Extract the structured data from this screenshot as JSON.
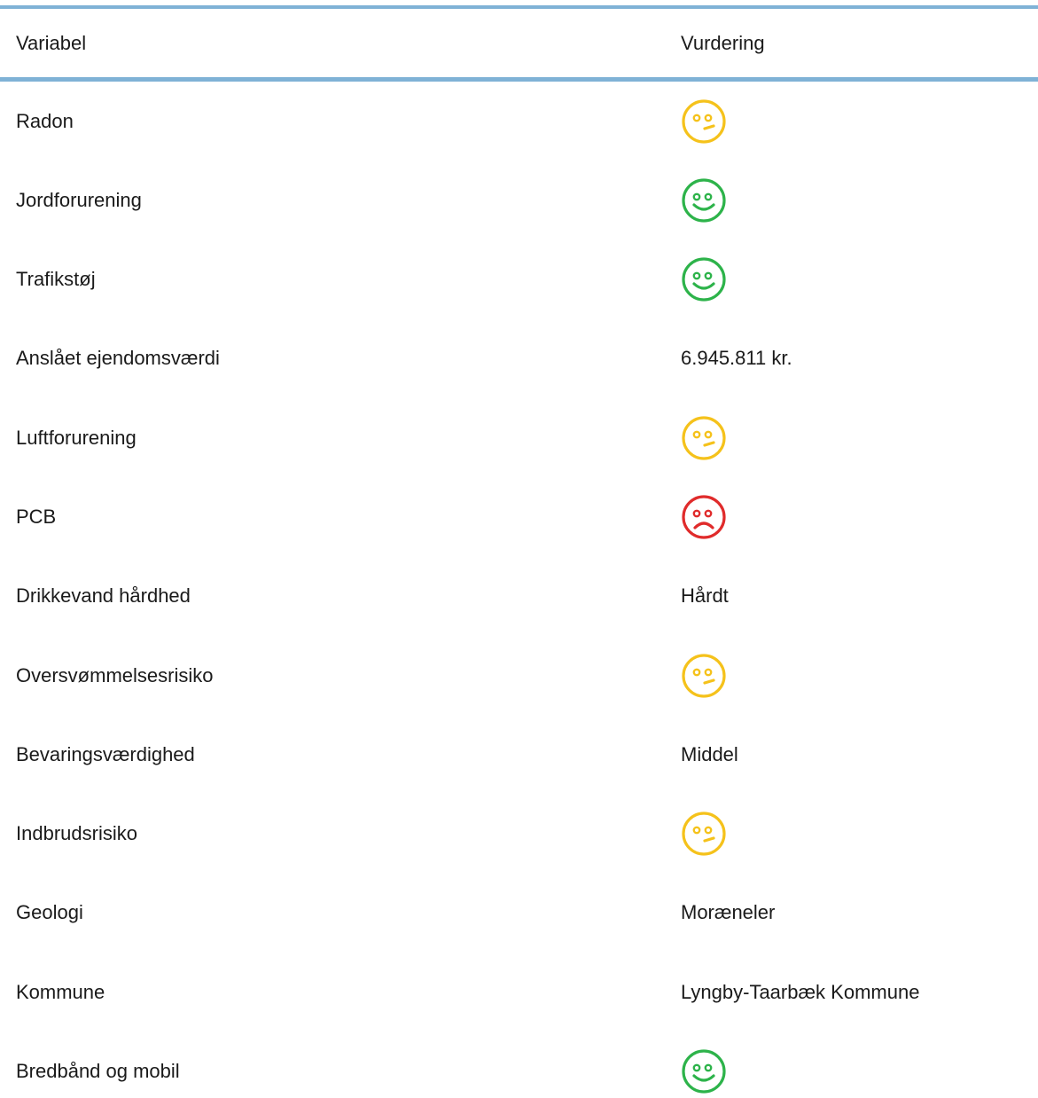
{
  "header": {
    "variable_label": "Variabel",
    "rating_label": "Vurdering"
  },
  "colors": {
    "header_border": "#7fb2d6",
    "good": "#2db34a",
    "neutral": "#f5c21b",
    "bad": "#e02b2b"
  },
  "rows": [
    {
      "label": "Radon",
      "type": "icon",
      "icon": "neutral-face-icon",
      "rating": "neutral"
    },
    {
      "label": "Jordforurening",
      "type": "icon",
      "icon": "happy-face-icon",
      "rating": "good"
    },
    {
      "label": "Trafikstøj",
      "type": "icon",
      "icon": "happy-face-icon",
      "rating": "good"
    },
    {
      "label": "Anslået ejendomsværdi",
      "type": "text",
      "value": "6.945.811 kr."
    },
    {
      "label": "Luftforurening",
      "type": "icon",
      "icon": "neutral-face-icon",
      "rating": "neutral"
    },
    {
      "label": "PCB",
      "type": "icon",
      "icon": "sad-face-icon",
      "rating": "bad"
    },
    {
      "label": "Drikkevand hårdhed",
      "type": "text",
      "value": "Hårdt"
    },
    {
      "label": "Oversvømmelsesrisiko",
      "type": "icon",
      "icon": "neutral-face-icon",
      "rating": "neutral"
    },
    {
      "label": "Bevaringsværdighed",
      "type": "text",
      "value": "Middel"
    },
    {
      "label": "Indbrudsrisiko",
      "type": "icon",
      "icon": "neutral-face-icon",
      "rating": "neutral"
    },
    {
      "label": "Geologi",
      "type": "text",
      "value": "Moræneler"
    },
    {
      "label": "Kommune",
      "type": "text",
      "value": "Lyngby-Taarbæk Kommune"
    },
    {
      "label": "Bredbånd og mobil",
      "type": "icon",
      "icon": "happy-face-icon",
      "rating": "good"
    }
  ]
}
